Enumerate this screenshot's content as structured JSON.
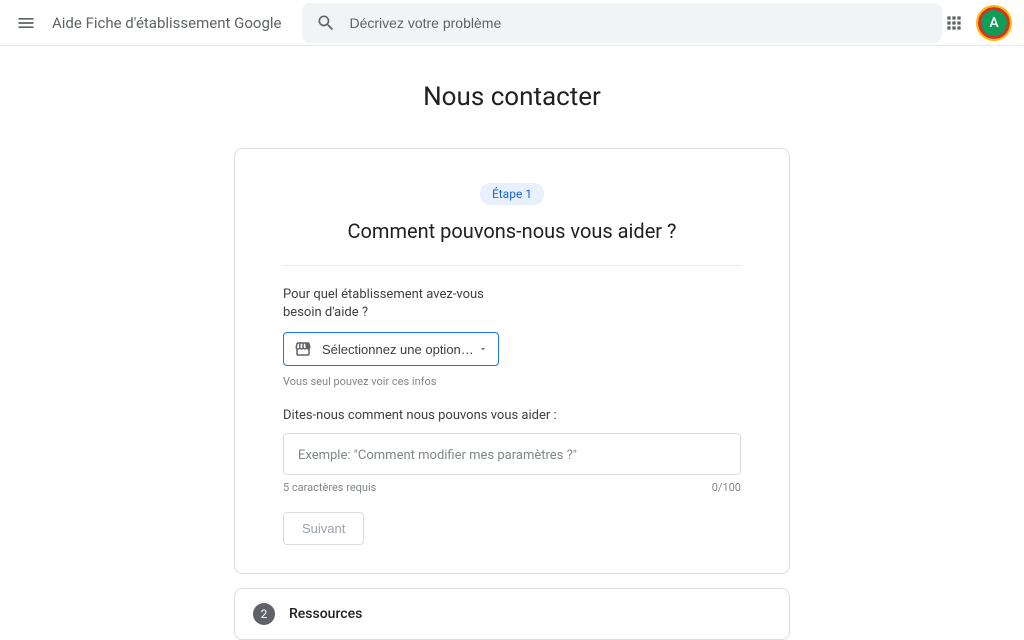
{
  "header": {
    "app_title": "Aide Fiche d'établissement Google",
    "search_placeholder": "Décrivez votre problème",
    "avatar_letter": "A"
  },
  "page": {
    "title": "Nous contacter"
  },
  "step1": {
    "badge": "Étape 1",
    "heading": "Comment pouvons-nous vous aider ?",
    "establishment_label": "Pour quel établissement avez-vous besoin d'aide ?",
    "select_placeholder": "Sélectionnez une option…",
    "privacy_note": "Vous seul pouvez voir ces infos",
    "describe_label": "Dites-nous comment nous pouvons vous aider :",
    "describe_placeholder": "Exemple: \"Comment modifier mes paramètres ?\"",
    "chars_required": "5 caractères requis",
    "char_count": "0/100",
    "next_button": "Suivant"
  },
  "step2": {
    "number": "2",
    "title": "Ressources"
  }
}
